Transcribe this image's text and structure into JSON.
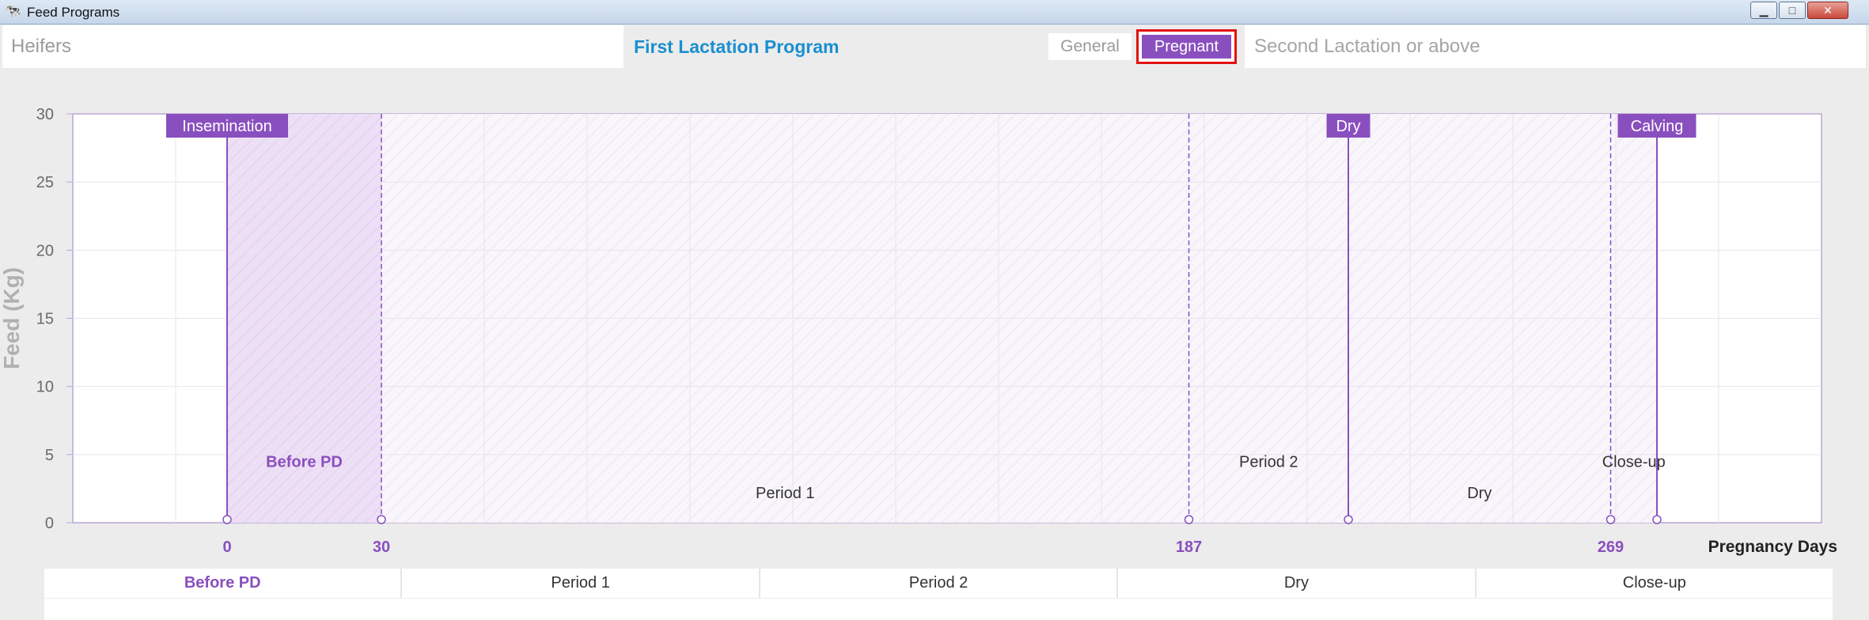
{
  "window": {
    "title": "Feed Programs",
    "icon": "cow-icon",
    "controls": {
      "minimize": "▁",
      "maximize": "□",
      "close": "✕"
    }
  },
  "program_tabs": {
    "heifers": "Heifers",
    "first_lactation": "First Lactation Program",
    "general": "General",
    "pregnant": "Pregnant",
    "second_lactation": "Second Lactation or above"
  },
  "colors": {
    "accent": "#8a4fbf",
    "active_tab_text": "#1a8fd0",
    "focus_border": "#e31010"
  },
  "chart_data": {
    "type": "area",
    "ylabel": "Feed (Kg)",
    "xlabel": "Pregnancy Days",
    "ylim": [
      0,
      30
    ],
    "yticks": [
      0,
      5,
      10,
      15,
      20,
      25,
      30
    ],
    "xlim": [
      -30,
      310
    ],
    "xticks": [
      0,
      30,
      187,
      269
    ],
    "grid": true,
    "markers": [
      {
        "label": "Insemination",
        "day": 0
      },
      {
        "label": "Dry",
        "day": 218
      },
      {
        "label": "Calving",
        "day": 278
      }
    ],
    "boundaries": [
      30,
      187,
      269
    ],
    "periods": [
      {
        "name": "Before PD",
        "start": 0,
        "end": 30,
        "label_y": 4.5
      },
      {
        "name": "Period 1",
        "start": 30,
        "end": 187,
        "label_y": 2.2
      },
      {
        "name": "Period 2",
        "start": 187,
        "end": 218,
        "label_y": 4.5
      },
      {
        "name": "Dry",
        "start": 218,
        "end": 269,
        "label_y": 2.2
      },
      {
        "name": "Close-up",
        "start": 269,
        "end": 278,
        "label_y": 4.5
      }
    ]
  },
  "period_table": {
    "headers": [
      "Before PD",
      "Period 1",
      "Period 2",
      "Dry",
      "Close-up"
    ]
  }
}
